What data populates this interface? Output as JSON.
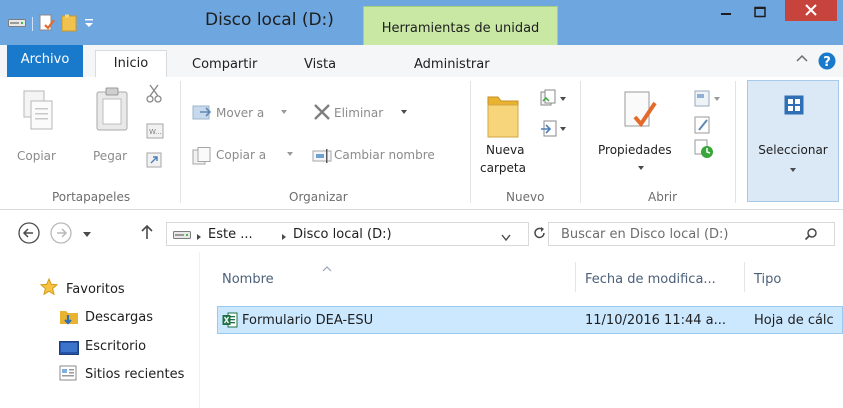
{
  "window": {
    "title": "Disco local (D:)",
    "contextual_tab": "Herramientas de unidad"
  },
  "ribbon_tabs": [
    "Archivo",
    "Inicio",
    "Compartir",
    "Vista",
    "Administrar"
  ],
  "ribbon": {
    "portapapeles": {
      "label": "Portapapeles",
      "copiar": "Copiar",
      "pegar": "Pegar"
    },
    "organizar": {
      "label": "Organizar",
      "mover_a": "Mover a",
      "copiar_a": "Copiar a",
      "eliminar": "Eliminar",
      "cambiar_nombre": "Cambiar nombre"
    },
    "nuevo": {
      "label": "Nuevo",
      "nueva_carpeta_1": "Nueva",
      "nueva_carpeta_2": "carpeta"
    },
    "abrir": {
      "label": "Abrir",
      "propiedades": "Propiedades"
    },
    "seleccionar": "Seleccionar"
  },
  "address": {
    "crumb_1": "Este ...",
    "crumb_2": "Disco local (D:)",
    "search_placeholder": "Buscar en Disco local (D:)"
  },
  "nav": {
    "favoritos": "Favoritos",
    "descargas": "Descargas",
    "escritorio": "Escritorio",
    "sitios": "Sitios recientes"
  },
  "columns": [
    "Nombre",
    "Fecha de modifica...",
    "Tipo"
  ],
  "files": [
    {
      "name": "Formulario DEA-ESU",
      "date": "11/10/2016 11:44 a...",
      "type": "Hoja de cálc"
    }
  ],
  "colors": {
    "titlebar": "#6ea6e0",
    "archivo_tab": "#1979ca",
    "context_tab": "#c9e8a4",
    "close_button": "#c7443c",
    "selection": "#cce8ff"
  }
}
